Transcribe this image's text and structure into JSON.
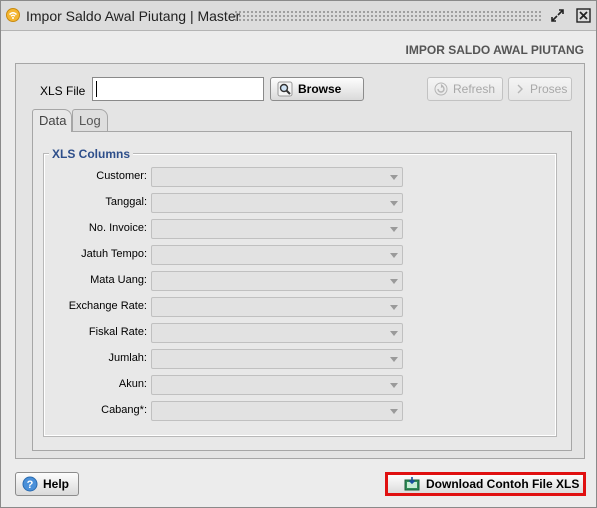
{
  "window": {
    "title": "Impor Saldo Awal Piutang | Master",
    "icon": "wifi-signal-icon",
    "maximize_icon": "restore-arrows-icon",
    "close_icon": "close-x-icon"
  },
  "header": {
    "title": "IMPOR SALDO AWAL PIUTANG"
  },
  "file": {
    "label": "XLS File",
    "value": "",
    "browse_label": "Browse",
    "refresh_label": "Refresh",
    "proses_label": "Proses"
  },
  "tabs": [
    {
      "label": "Data",
      "active": true
    },
    {
      "label": "Log",
      "active": false
    }
  ],
  "columns": {
    "legend": "XLS Columns",
    "fields": [
      {
        "label": "Customer:",
        "value": ""
      },
      {
        "label": "Tanggal:",
        "value": ""
      },
      {
        "label": "No. Invoice:",
        "value": ""
      },
      {
        "label": "Jatuh Tempo:",
        "value": ""
      },
      {
        "label": "Mata Uang:",
        "value": ""
      },
      {
        "label": "Exchange Rate:",
        "value": ""
      },
      {
        "label": "Fiskal Rate:",
        "value": ""
      },
      {
        "label": "Jumlah:",
        "value": ""
      },
      {
        "label": "Akun:",
        "value": ""
      },
      {
        "label": "Cabang*:",
        "value": ""
      }
    ]
  },
  "footer": {
    "help_label": "Help",
    "download_label": "Download Contoh File XLS"
  },
  "colors": {
    "legend": "#2d4e8a",
    "highlight_border": "#e01010",
    "title_icon": "#e8a317"
  }
}
